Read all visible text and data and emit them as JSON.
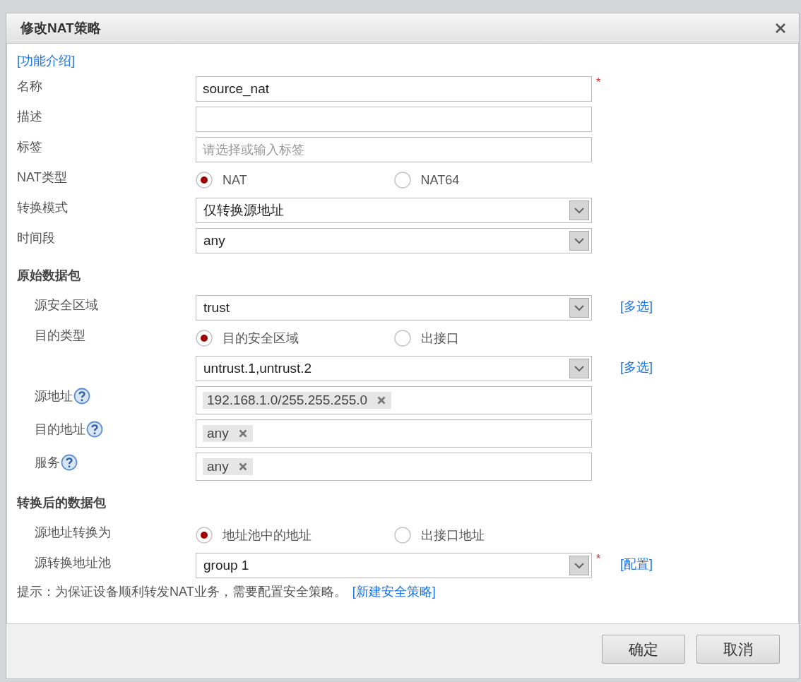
{
  "dialog": {
    "title": "修改NAT策略",
    "intro_link": "[功能介绍]",
    "fields": [
      {
        "kind": "text",
        "label": "名称",
        "value": "source_nat",
        "required_mark": "*"
      },
      {
        "kind": "text",
        "label": "描述"
      },
      {
        "kind": "text",
        "label": "标签",
        "placeholder": "请选择或输入标签"
      },
      {
        "kind": "radio",
        "label": "NAT类型",
        "options": [
          {
            "label": "NAT",
            "selected": true
          },
          {
            "label": "NAT64",
            "selected": false
          }
        ]
      },
      {
        "kind": "select",
        "label": "转换模式",
        "value": "仅转换源地址"
      },
      {
        "kind": "select",
        "label": "时间段",
        "value": "any"
      }
    ],
    "sections": [
      {
        "title": "原始数据包",
        "fields": [
          {
            "kind": "select",
            "label": "源安全区域",
            "value": "trust",
            "link": "[多选]"
          },
          {
            "kind": "radio",
            "label": "目的类型",
            "options": [
              {
                "label": "目的安全区域",
                "selected": true
              },
              {
                "label": "出接口",
                "selected": false
              }
            ]
          },
          {
            "kind": "select",
            "value": "untrust.1,untrust.2",
            "link": "[多选]"
          },
          {
            "kind": "tags",
            "label": "源地址",
            "help": true,
            "tags": [
              "192.168.1.0/255.255.255.0"
            ]
          },
          {
            "kind": "tags",
            "label": "目的地址",
            "help": true,
            "tags": [
              "any"
            ]
          },
          {
            "kind": "tags",
            "label": "服务",
            "help": true,
            "tags": [
              "any"
            ]
          }
        ]
      },
      {
        "title": "转换后的数据包",
        "fields": [
          {
            "kind": "radio",
            "label": "源地址转换为",
            "options": [
              {
                "label": "地址池中的地址",
                "selected": true
              },
              {
                "label": "出接口地址",
                "selected": false
              }
            ]
          },
          {
            "kind": "select",
            "label": "源转换地址池",
            "value": "group 1",
            "required_mark": "*",
            "link": "[配置]"
          }
        ]
      }
    ],
    "hint": {
      "text": "提示：为保证设备顺利转发NAT业务，需要配置安全策略。",
      "link": "[新建安全策略]"
    },
    "buttons": [
      "确定",
      "取消"
    ]
  }
}
